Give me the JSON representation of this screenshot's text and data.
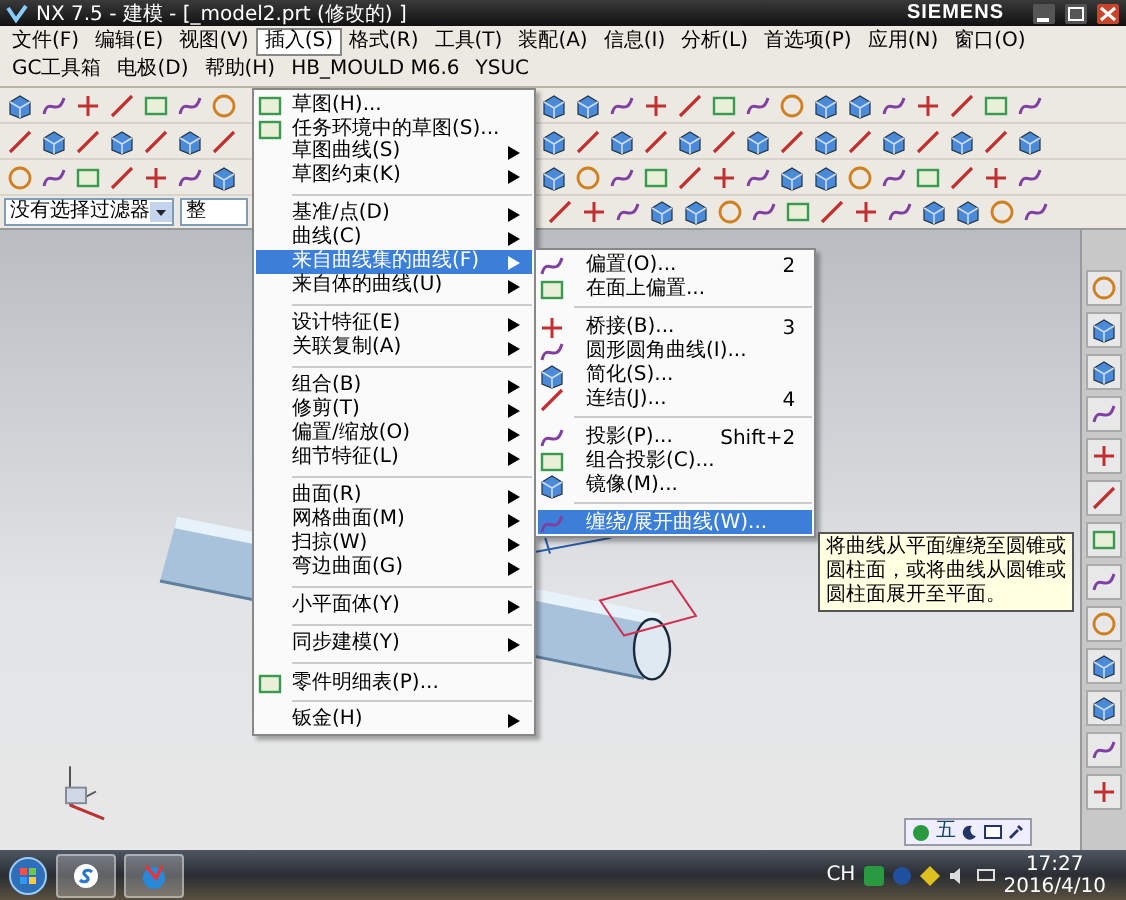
{
  "window": {
    "title": "NX 7.5 - 建模 - [_model2.prt (修改的) ]",
    "brand": "SIEMENS"
  },
  "menubar": [
    {
      "label": "文件(F)",
      "selected": false
    },
    {
      "label": "编辑(E)",
      "selected": false
    },
    {
      "label": "视图(V)",
      "selected": false
    },
    {
      "label": "插入(S)",
      "selected": true
    },
    {
      "label": "格式(R)",
      "selected": false
    },
    {
      "label": "工具(T)",
      "selected": false
    },
    {
      "label": "装配(A)",
      "selected": false
    },
    {
      "label": "信息(I)",
      "selected": false
    },
    {
      "label": "分析(L)",
      "selected": false
    },
    {
      "label": "首选项(P)",
      "selected": false
    },
    {
      "label": "应用(N)",
      "selected": false
    },
    {
      "label": "窗口(O)",
      "selected": false
    },
    {
      "label": "GC工具箱",
      "selected": false
    },
    {
      "label": "电极(D)",
      "selected": false
    },
    {
      "label": "帮助(H)",
      "selected": false
    },
    {
      "label": "HB_MOULD M6.6",
      "selected": false
    },
    {
      "label": "YSUC",
      "selected": false
    }
  ],
  "filter_bar": {
    "type_filter": "没有选择过滤器",
    "scope": "整"
  },
  "insert_menu": {
    "items": [
      {
        "kind": "icon_item",
        "label": "草图(H)...",
        "submenu": false,
        "selected": false
      },
      {
        "kind": "icon_item",
        "label": "任务环境中的草图(S)...",
        "submenu": false,
        "selected": false
      },
      {
        "kind": "item",
        "label": "草图曲线(S)",
        "submenu": true,
        "selected": false
      },
      {
        "kind": "item",
        "label": "草图约束(K)",
        "submenu": true,
        "selected": false
      },
      {
        "kind": "separator"
      },
      {
        "kind": "item",
        "label": "基准/点(D)",
        "submenu": true,
        "selected": false
      },
      {
        "kind": "item",
        "label": "曲线(C)",
        "submenu": true,
        "selected": false
      },
      {
        "kind": "item",
        "label": "来自曲线集的曲线(F)",
        "submenu": true,
        "selected": true
      },
      {
        "kind": "item",
        "label": "来自体的曲线(U)",
        "submenu": true,
        "selected": false
      },
      {
        "kind": "separator"
      },
      {
        "kind": "item",
        "label": "设计特征(E)",
        "submenu": true,
        "selected": false
      },
      {
        "kind": "item",
        "label": "关联复制(A)",
        "submenu": true,
        "selected": false
      },
      {
        "kind": "separator"
      },
      {
        "kind": "item",
        "label": "组合(B)",
        "submenu": true,
        "selected": false
      },
      {
        "kind": "item",
        "label": "修剪(T)",
        "submenu": true,
        "selected": false
      },
      {
        "kind": "item",
        "label": "偏置/缩放(O)",
        "submenu": true,
        "selected": false
      },
      {
        "kind": "item",
        "label": "细节特征(L)",
        "submenu": true,
        "selected": false
      },
      {
        "kind": "separator"
      },
      {
        "kind": "item",
        "label": "曲面(R)",
        "submenu": true,
        "selected": false
      },
      {
        "kind": "item",
        "label": "网格曲面(M)",
        "submenu": true,
        "selected": false
      },
      {
        "kind": "item",
        "label": "扫掠(W)",
        "submenu": true,
        "selected": false
      },
      {
        "kind": "item",
        "label": "弯边曲面(G)",
        "submenu": true,
        "selected": false
      },
      {
        "kind": "separator"
      },
      {
        "kind": "item",
        "label": "小平面体(Y)",
        "submenu": true,
        "selected": false
      },
      {
        "kind": "separator"
      },
      {
        "kind": "item",
        "label": "同步建模(Y)",
        "submenu": true,
        "selected": false
      },
      {
        "kind": "separator"
      },
      {
        "kind": "icon_item",
        "label": "零件明细表(P)...",
        "submenu": false,
        "selected": false
      },
      {
        "kind": "separator"
      },
      {
        "kind": "item",
        "label": "钣金(H)",
        "submenu": true,
        "selected": false
      }
    ]
  },
  "curve_submenu": {
    "items": [
      {
        "kind": "icon_item",
        "label": "偏置(O)...",
        "shortcut": "2",
        "selected": false
      },
      {
        "kind": "icon_item",
        "label": "在面上偏置...",
        "selected": false
      },
      {
        "kind": "separator"
      },
      {
        "kind": "icon_item",
        "label": "桥接(B)...",
        "shortcut": "3",
        "selected": false
      },
      {
        "kind": "icon_item",
        "label": "圆形圆角曲线(I)...",
        "selected": false
      },
      {
        "kind": "icon_item",
        "label": "简化(S)...",
        "selected": false
      },
      {
        "kind": "icon_item",
        "label": "连结(J)...",
        "shortcut": "4",
        "selected": false
      },
      {
        "kind": "separator"
      },
      {
        "kind": "icon_item",
        "label": "投影(P)...",
        "shortcut": "Shift+2",
        "selected": false
      },
      {
        "kind": "icon_item",
        "label": "组合投影(C)...",
        "selected": false
      },
      {
        "kind": "icon_item",
        "label": "镜像(M)...",
        "selected": false
      },
      {
        "kind": "separator"
      },
      {
        "kind": "icon_item",
        "label": "缠绕/展开曲线(W)...",
        "selected": true
      }
    ]
  },
  "tooltip": "将曲线从平面缠绕至圆锥或圆柱面，或将曲线从圆锥或圆柱面展开至平面。",
  "ime_bar": {
    "mode": "五"
  },
  "taskbar": {
    "language": "CH",
    "time": "17:27",
    "date": "2016/4/10"
  }
}
